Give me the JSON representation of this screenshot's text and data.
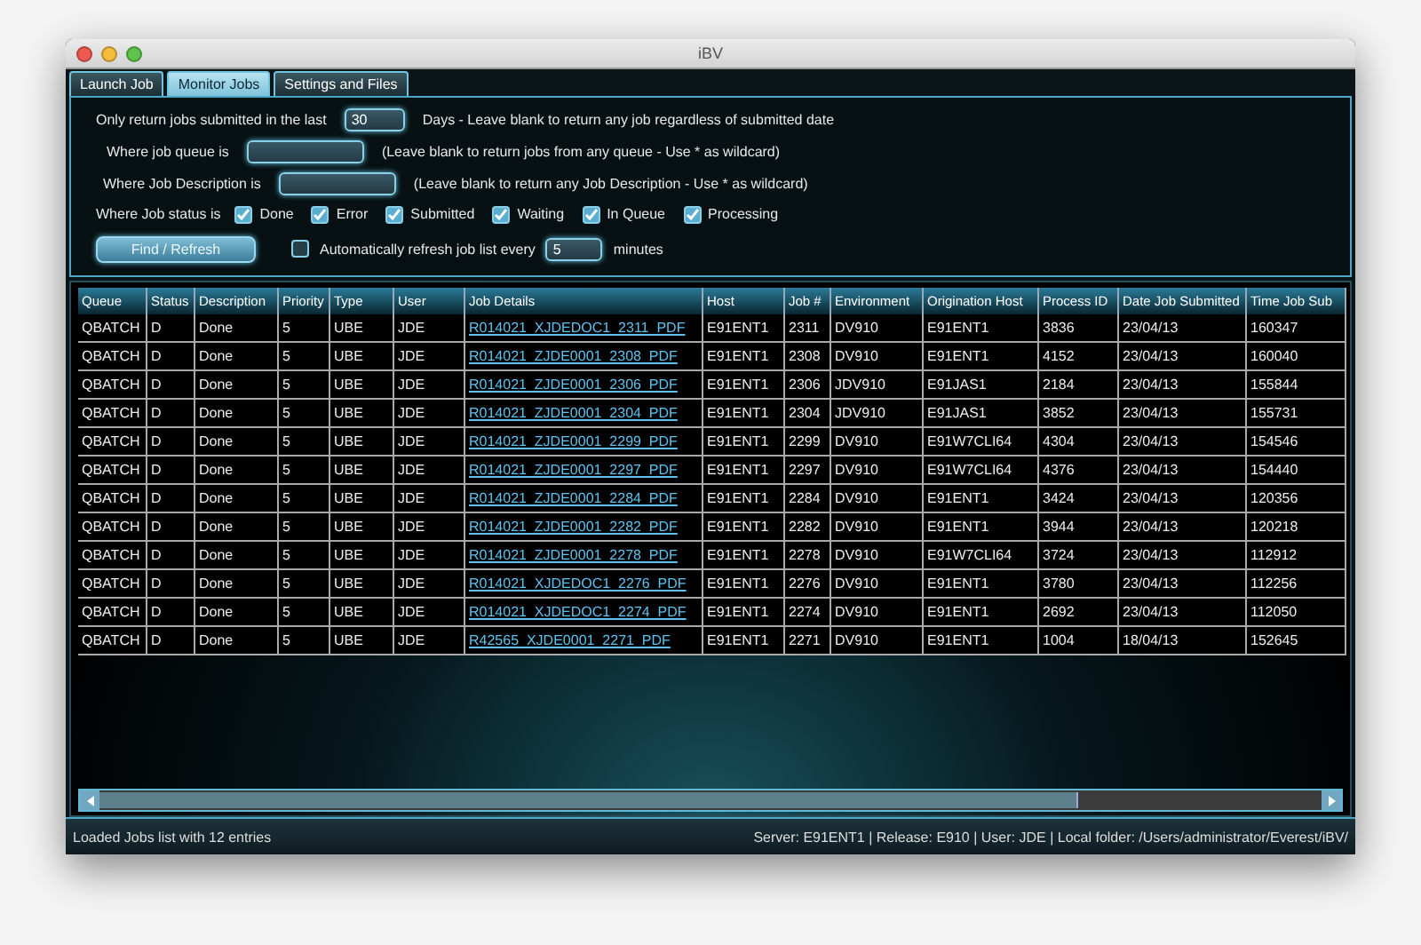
{
  "window": {
    "title": "iBV"
  },
  "tabs": [
    {
      "label": "Launch Job",
      "selected": false
    },
    {
      "label": "Monitor Jobs",
      "selected": true
    },
    {
      "label": "Settings and Files",
      "selected": false
    }
  ],
  "filters": {
    "days": {
      "label": "Only return jobs submitted in the last",
      "value": "30",
      "hint": "Days - Leave blank to return any job regardless of submitted date"
    },
    "queue": {
      "label": "Where job queue is",
      "hint": "(Leave blank to return jobs from any queue - Use * as wildcard)"
    },
    "description": {
      "label": "Where Job Description is",
      "hint": "(Leave blank to return any Job Description - Use * as wildcard)"
    },
    "status": {
      "label": "Where Job status is",
      "options": [
        {
          "label": "Done",
          "checked": true
        },
        {
          "label": "Error",
          "checked": true
        },
        {
          "label": "Submitted",
          "checked": true
        },
        {
          "label": "Waiting",
          "checked": true
        },
        {
          "label": "In Queue",
          "checked": true
        },
        {
          "label": "Processing",
          "checked": true
        }
      ]
    },
    "find_button": "Find / Refresh",
    "auto_refresh": {
      "label": "Automatically refresh job list every",
      "checked": false,
      "value": "5",
      "unit": "minutes"
    }
  },
  "table": {
    "columns": [
      {
        "label": "Queue",
        "kind": "text"
      },
      {
        "label": "Status",
        "kind": "text"
      },
      {
        "label": "Description",
        "kind": "text"
      },
      {
        "label": "Priority",
        "kind": "text"
      },
      {
        "label": "Type",
        "kind": "text"
      },
      {
        "label": "User",
        "kind": "text"
      },
      {
        "label": "Job Details",
        "kind": "link"
      },
      {
        "label": "Host",
        "kind": "text"
      },
      {
        "label": "Job #",
        "kind": "text"
      },
      {
        "label": "Environment",
        "kind": "text"
      },
      {
        "label": "Origination Host",
        "kind": "text"
      },
      {
        "label": "Process ID",
        "kind": "text"
      },
      {
        "label": "Date Job Submitted",
        "kind": "text"
      },
      {
        "label": "Time Job Sub",
        "kind": "text"
      }
    ],
    "rows": [
      [
        "QBATCH",
        "D",
        "Done",
        "5",
        "UBE",
        "JDE",
        "R014021_XJDEDOC1_2311_PDF",
        "E91ENT1",
        "2311",
        "DV910",
        "E91ENT1",
        "3836",
        "23/04/13",
        "160347"
      ],
      [
        "QBATCH",
        "D",
        "Done",
        "5",
        "UBE",
        "JDE",
        "R014021_ZJDE0001_2308_PDF",
        "E91ENT1",
        "2308",
        "DV910",
        "E91ENT1",
        "4152",
        "23/04/13",
        "160040"
      ],
      [
        "QBATCH",
        "D",
        "Done",
        "5",
        "UBE",
        "JDE",
        "R014021_ZJDE0001_2306_PDF",
        "E91ENT1",
        "2306",
        "JDV910",
        "E91JAS1",
        "2184",
        "23/04/13",
        "155844"
      ],
      [
        "QBATCH",
        "D",
        "Done",
        "5",
        "UBE",
        "JDE",
        "R014021_ZJDE0001_2304_PDF",
        "E91ENT1",
        "2304",
        "JDV910",
        "E91JAS1",
        "3852",
        "23/04/13",
        "155731"
      ],
      [
        "QBATCH",
        "D",
        "Done",
        "5",
        "UBE",
        "JDE",
        "R014021_ZJDE0001_2299_PDF",
        "E91ENT1",
        "2299",
        "DV910",
        "E91W7CLI64",
        "4304",
        "23/04/13",
        "154546"
      ],
      [
        "QBATCH",
        "D",
        "Done",
        "5",
        "UBE",
        "JDE",
        "R014021_ZJDE0001_2297_PDF",
        "E91ENT1",
        "2297",
        "DV910",
        "E91W7CLI64",
        "4376",
        "23/04/13",
        "154440"
      ],
      [
        "QBATCH",
        "D",
        "Done",
        "5",
        "UBE",
        "JDE",
        "R014021_ZJDE0001_2284_PDF",
        "E91ENT1",
        "2284",
        "DV910",
        "E91ENT1",
        "3424",
        "23/04/13",
        "120356"
      ],
      [
        "QBATCH",
        "D",
        "Done",
        "5",
        "UBE",
        "JDE",
        "R014021_ZJDE0001_2282_PDF",
        "E91ENT1",
        "2282",
        "DV910",
        "E91ENT1",
        "3944",
        "23/04/13",
        "120218"
      ],
      [
        "QBATCH",
        "D",
        "Done",
        "5",
        "UBE",
        "JDE",
        "R014021_ZJDE0001_2278_PDF",
        "E91ENT1",
        "2278",
        "DV910",
        "E91W7CLI64",
        "3724",
        "23/04/13",
        "112912"
      ],
      [
        "QBATCH",
        "D",
        "Done",
        "5",
        "UBE",
        "JDE",
        "R014021_XJDEDOC1_2276_PDF",
        "E91ENT1",
        "2276",
        "DV910",
        "E91ENT1",
        "3780",
        "23/04/13",
        "112256"
      ],
      [
        "QBATCH",
        "D",
        "Done",
        "5",
        "UBE",
        "JDE",
        "R014021_XJDEDOC1_2274_PDF",
        "E91ENT1",
        "2274",
        "DV910",
        "E91ENT1",
        "2692",
        "23/04/13",
        "112050"
      ],
      [
        "QBATCH",
        "D",
        "Done",
        "5",
        "UBE",
        "JDE",
        "R42565_XJDE0001_2271_PDF",
        "E91ENT1",
        "2271",
        "DV910",
        "E91ENT1",
        "1004",
        "18/04/13",
        "152645"
      ]
    ]
  },
  "status_bar": {
    "message": "Loaded Jobs list with 12 entries",
    "info": "Server: E91ENT1 | Release: E910 | User: JDE | Local folder: /Users/administrator/Everest/iBV/"
  }
}
